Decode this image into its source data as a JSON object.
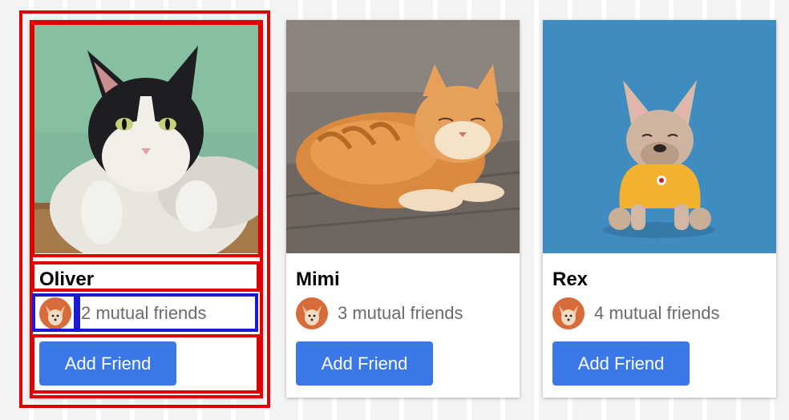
{
  "colors": {
    "accent": "#3b78e7",
    "highlight_red": "#e00000",
    "highlight_blue": "#1a1ad6",
    "mutual_text": "#6b6b6b"
  },
  "cards": [
    {
      "name": "Oliver",
      "photo": "black-and-white-cat-photo",
      "mutual_friends": "2 mutual friends",
      "avatar": "chihuahua-avatar",
      "button_label": "Add Friend"
    },
    {
      "name": "Mimi",
      "photo": "orange-tabby-cat-photo",
      "mutual_friends": "3 mutual friends",
      "avatar": "chihuahua-avatar",
      "button_label": "Add Friend"
    },
    {
      "name": "Rex",
      "photo": "french-bulldog-photo",
      "mutual_friends": "4 mutual friends",
      "avatar": "chihuahua-avatar",
      "button_label": "Add Friend"
    }
  ]
}
